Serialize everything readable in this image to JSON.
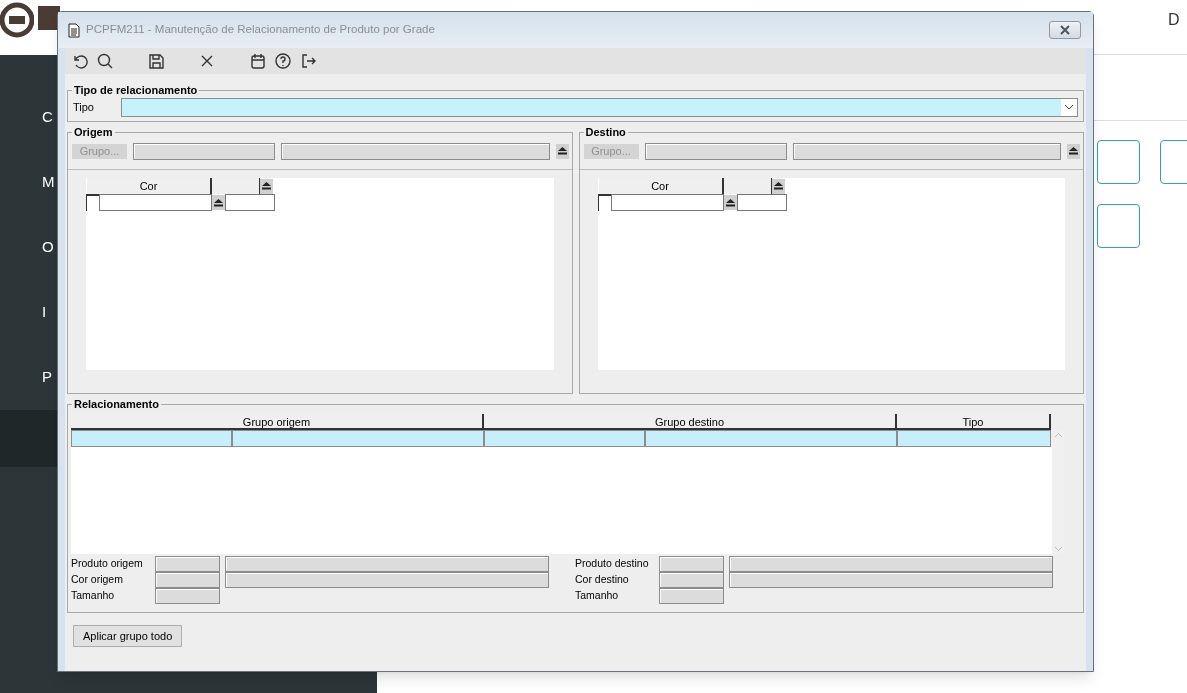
{
  "background": {
    "sidebar_items": [
      {
        "label": "C",
        "selected": false
      },
      {
        "label": "M",
        "selected": false
      },
      {
        "label": "O",
        "selected": false
      },
      {
        "label": "I",
        "selected": false
      },
      {
        "label": "P",
        "selected": false
      },
      {
        "selected": true
      }
    ],
    "header_text": "D"
  },
  "window": {
    "title": "PCPFM211 - Manutenção de Relacionamento de Produto por Grade"
  },
  "toolbar": [
    {
      "kind": "undo"
    },
    {
      "kind": "search"
    },
    {
      "kind": "save"
    },
    {
      "kind": "cancel"
    },
    {
      "kind": "calendar"
    },
    {
      "kind": "help"
    },
    {
      "kind": "exit"
    }
  ],
  "tipo_section": {
    "legend": "Tipo de relacionamento",
    "label": "Tipo"
  },
  "panels": [
    {
      "legend": "Origem",
      "button": {
        "label": "Grupo...",
        "disabled": true
      },
      "grid_columns": [
        "Cor"
      ]
    },
    {
      "legend": "Destino",
      "button": {
        "label": "Grupo...",
        "disabled": true
      },
      "grid_columns": [
        "Cor"
      ]
    }
  ],
  "relacionamento": {
    "legend": "Relacionamento",
    "columns": [
      "Grupo origem",
      "Grupo destino",
      "Tipo"
    ],
    "rows": [
      {
        "selected": true
      }
    ],
    "details": [
      {
        "labels": [
          "Produto origem",
          "Cor origem",
          "Tamanho"
        ]
      },
      {
        "labels": [
          "Produto destino",
          "Cor destino",
          "Tamanho"
        ]
      }
    ]
  },
  "buttons": [
    "Aplicar grupo todo"
  ]
}
